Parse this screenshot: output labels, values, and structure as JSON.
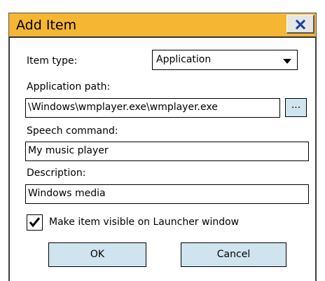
{
  "window": {
    "title": "Add Item",
    "title_bar_color": "#f5b633",
    "close_icon": "close-icon"
  },
  "form": {
    "item_type_label": "Item type:",
    "item_type_value": "Application",
    "app_path_label": "Application path:",
    "app_path_value": "\\Windows\\wmplayer.exe\\wmplayer.exe",
    "browse_label": "...",
    "speech_label": "Speech command:",
    "speech_value": "My music player",
    "description_label": "Description:",
    "description_value": "Windows media",
    "visible_checked": true,
    "visible_label": "Make item visible on Launcher window"
  },
  "buttons": {
    "ok": "OK",
    "cancel": "Cancel",
    "button_color": "#cfe4ef"
  }
}
